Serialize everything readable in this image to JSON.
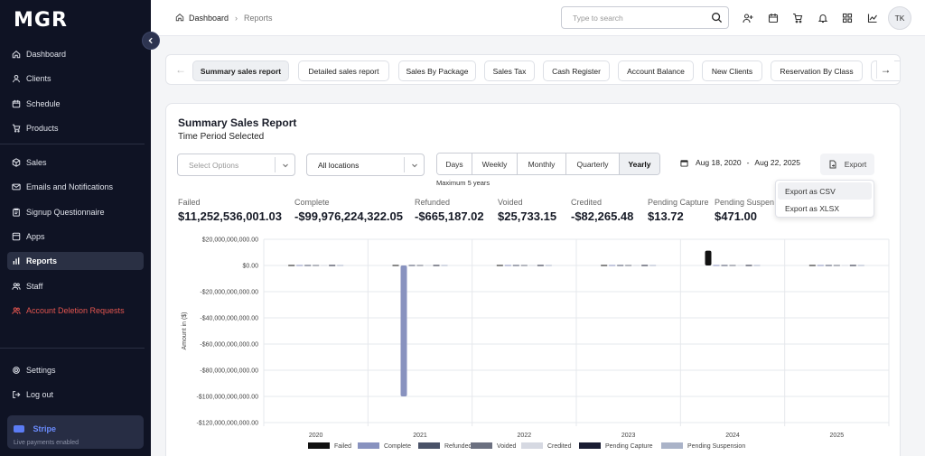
{
  "app": {
    "logo": "MGR"
  },
  "sidebar": {
    "items": [
      {
        "label": "Dashboard",
        "icon": "home-icon"
      },
      {
        "label": "Clients",
        "icon": "user-icon"
      },
      {
        "label": "Schedule",
        "icon": "calendar-icon"
      },
      {
        "label": "Products",
        "icon": "cart-icon"
      },
      {
        "label": "Sales",
        "icon": "box-icon"
      },
      {
        "label": "Emails and Notifications",
        "icon": "mail-icon"
      },
      {
        "label": "Signup Questionnaire",
        "icon": "clipboard-icon"
      },
      {
        "label": "Apps",
        "icon": "apps-icon"
      },
      {
        "label": "Reports",
        "icon": "bar-chart-icon"
      },
      {
        "label": "Staff",
        "icon": "users-icon"
      },
      {
        "label": "Account Deletion Requests",
        "icon": "user-x-icon"
      }
    ],
    "bottom": [
      {
        "label": "Settings",
        "icon": "gear-icon"
      },
      {
        "label": "Log out",
        "icon": "logout-icon"
      }
    ],
    "stripe": {
      "title": "Stripe",
      "subtitle": "Live payments enabled"
    }
  },
  "header": {
    "breadcrumb": [
      "Dashboard",
      "Reports"
    ],
    "search_placeholder": "Type to search",
    "avatar_initials": "TK"
  },
  "tabs": [
    "Summary sales report",
    "Detailed sales report",
    "Sales By Package",
    "Sales Tax",
    "Cash Register",
    "Account Balance",
    "New Clients",
    "Reservation By Class"
  ],
  "report": {
    "title": "Summary Sales Report",
    "subtitle": "Time Period Selected",
    "options_placeholder": "Select Options",
    "location_value": "All locations",
    "periods": [
      "Days",
      "Weekly",
      "Monthly",
      "Quarterly",
      "Yearly"
    ],
    "selected_period": "Yearly",
    "max_note": "Maximum 5 years",
    "date_start": "Aug 18, 2020",
    "date_end": "Aug 22, 2025",
    "date_sep": "-",
    "export_label": "Export",
    "export_options": [
      "Export as CSV",
      "Export as XLSX"
    ]
  },
  "stats": [
    {
      "label": "Failed",
      "value": "$11,252,536,001.03"
    },
    {
      "label": "Complete",
      "value": "-$99,976,224,322.05"
    },
    {
      "label": "Refunded",
      "value": "-$665,187.02"
    },
    {
      "label": "Voided",
      "value": "$25,733.15"
    },
    {
      "label": "Credited",
      "value": "-$82,265.48"
    },
    {
      "label": "Pending Capture",
      "value": "$13.72"
    },
    {
      "label": "Pending Suspension",
      "value": "$471.00"
    }
  ],
  "chart_data": {
    "type": "bar",
    "ylabel": "Amount in ($)",
    "ylim": [
      -120000000000,
      20000000000
    ],
    "yticks": [
      20000000000,
      0,
      -20000000000,
      -40000000000,
      -60000000000,
      -80000000000,
      -100000000000,
      -120000000000
    ],
    "ytick_labels": [
      "$20,000,000,000.00",
      "$0.00",
      "-$20,000,000,000.00",
      "-$40,000,000,000.00",
      "-$60,000,000,000.00",
      "-$80,000,000,000.00",
      "-$100,000,000,000.00",
      "-$120,000,000,000.00"
    ],
    "categories": [
      "2020",
      "2021",
      "2022",
      "2023",
      "2024",
      "2025"
    ],
    "legend_position": "bottom",
    "series": [
      {
        "name": "Failed",
        "color": "#111111",
        "values": [
          0,
          0,
          0,
          0,
          11252536001.03,
          0
        ]
      },
      {
        "name": "Complete",
        "color": "#8892bf",
        "values": [
          0,
          -99976224322.05,
          0,
          0,
          0,
          0
        ]
      },
      {
        "name": "Refunded",
        "color": "#4a5268",
        "values": [
          0,
          -665187.02,
          0,
          0,
          0,
          0
        ]
      },
      {
        "name": "Voided",
        "color": "#6b7080",
        "values": [
          0,
          25733.15,
          0,
          0,
          0,
          0
        ]
      },
      {
        "name": "Credited",
        "color": "#d6d9e2",
        "values": [
          0,
          -82265.48,
          0,
          0,
          0,
          0
        ]
      },
      {
        "name": "Pending Capture",
        "color": "#1a1d33",
        "values": [
          0,
          13.72,
          0,
          0,
          0,
          0
        ]
      },
      {
        "name": "Pending Suspension",
        "color": "#aab3c8",
        "values": [
          0,
          471,
          0,
          0,
          0,
          0
        ]
      }
    ]
  }
}
